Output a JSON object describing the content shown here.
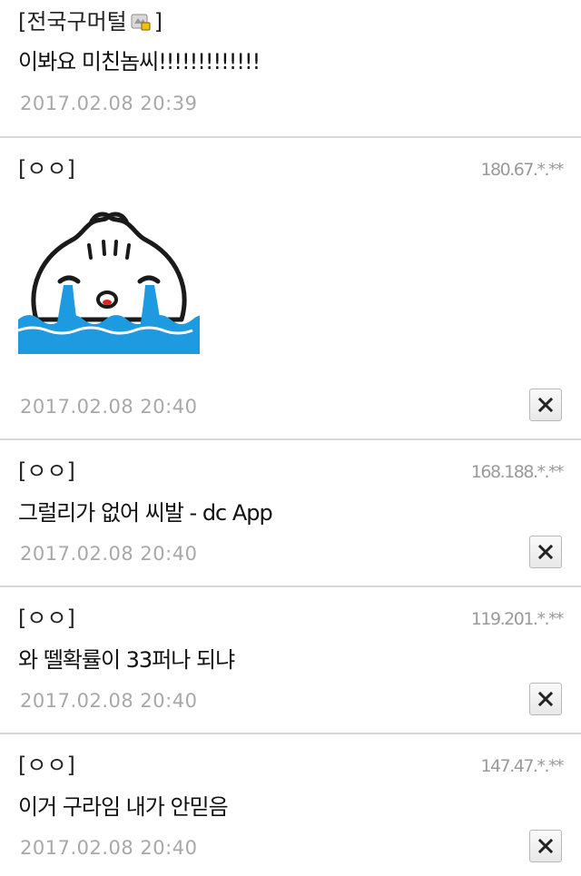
{
  "comments": [
    {
      "author": "[전국구머털",
      "author_suffix": "]",
      "author_badge": "gallog-icon",
      "text": "이봐요 미친놈씨!!!!!!!!!!!!!",
      "date": "2017.02.08 20:39"
    },
    {
      "author": "[ㅇㅇ]",
      "ip": "180.67.*.**",
      "sticker": "crying-dumpling-sticker",
      "date": "2017.02.08 20:40"
    },
    {
      "author": "[ㅇㅇ]",
      "ip": "168.188.*.**",
      "text": "그럴리가 없어 씨발 - dc App",
      "date": "2017.02.08 20:40"
    },
    {
      "author": "[ㅇㅇ]",
      "ip": "119.201.*.**",
      "text": "와 뗄확률이 33퍼나 되냐",
      "date": "2017.02.08 20:40"
    },
    {
      "author": "[ㅇㅇ]",
      "ip": "147.47.*.**",
      "text": "이거 구라임 내가 안믿음",
      "date": "2017.02.08 20:40"
    }
  ],
  "delete_icon": "close-icon",
  "colors": {
    "divider": "#d8d8d8",
    "date": "#a8a8a8",
    "ip": "#9a9a9a",
    "sticker_water": "#1e9be0"
  }
}
